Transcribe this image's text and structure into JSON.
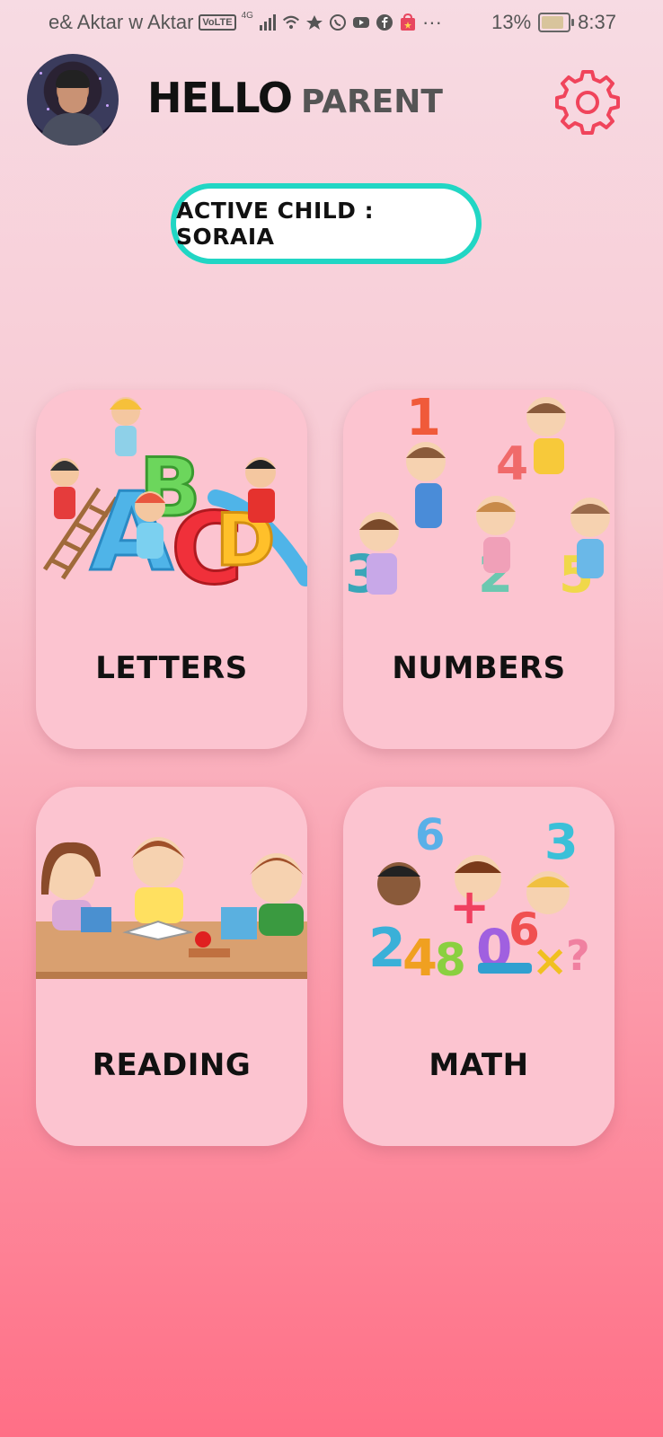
{
  "status_bar": {
    "carrier": "e& Aktar w Aktar",
    "volte": "VoLTE",
    "network": "4G",
    "more": "···",
    "battery": "13%",
    "time": "8:37"
  },
  "header": {
    "hello": "HELLO",
    "role": "PARENT"
  },
  "active_child": {
    "label": "ACTIVE CHILD : SORAIA"
  },
  "categories": [
    {
      "label": "LETTERS"
    },
    {
      "label": "NUMBERS"
    },
    {
      "label": "READING"
    },
    {
      "label": "MATH"
    }
  ],
  "colors": {
    "accent_teal": "#21d6c4",
    "gear_red": "#f0445b",
    "card_bg": "#fcc4d0"
  }
}
